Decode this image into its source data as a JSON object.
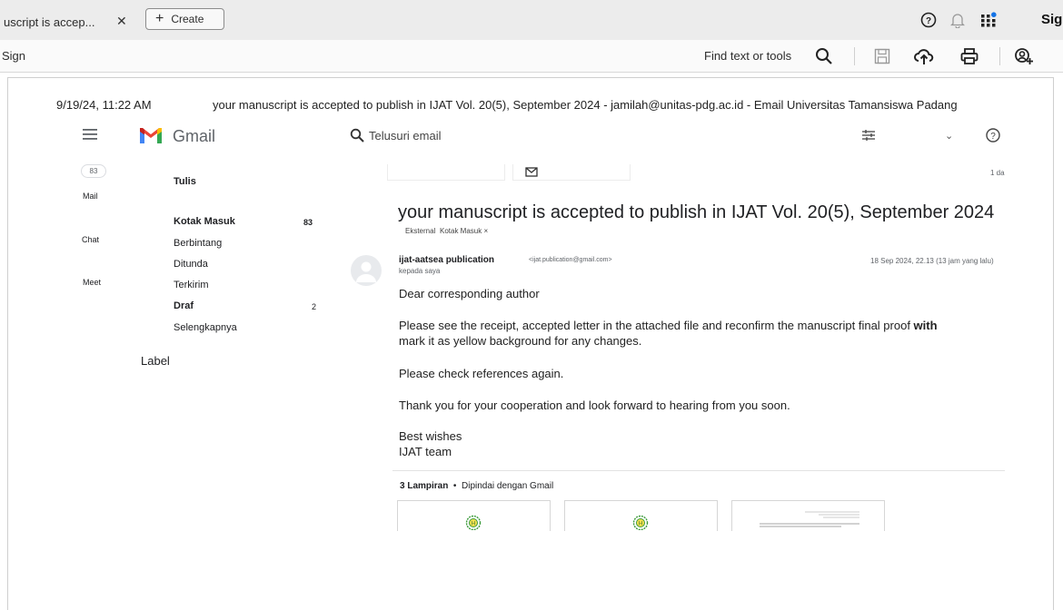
{
  "acrobat": {
    "tab_title": "uscript is accep...",
    "tab_close": "✕",
    "create_label": "Create",
    "create_plus": "+",
    "top_right_label": "Sig",
    "sign_label": "Sign",
    "find_label": "Find text or tools",
    "icons": [
      "help-icon",
      "bell-icon",
      "apps-icon",
      "search-icon",
      "save-icon",
      "upload-cloud-icon",
      "print-icon",
      "share-user-icon"
    ]
  },
  "print_header": {
    "datetime": "9/19/24, 11:22 AM",
    "subject": "your manuscript is accepted to publish in IJAT Vol. 20(5), September 2024 - jamilah@unitas-pdg.ac.id - Email Universitas Tamansiswa Padang"
  },
  "gmail": {
    "brand": "Gmail",
    "search_placeholder": "Telusuri email",
    "rail": {
      "badge": "83",
      "mail": "Mail",
      "chat": "Chat",
      "meet": "Meet"
    },
    "nav": {
      "compose": "Tulis",
      "inbox": "Kotak Masuk",
      "inbox_count": "83",
      "starred": "Berbintang",
      "snoozed": "Ditunda",
      "sent": "Terkirim",
      "drafts": "Draf",
      "drafts_count": "2",
      "more": "Selengkapnya",
      "labels": "Label"
    },
    "colors": {
      "red": "#ea4335",
      "blue": "#4285f4",
      "green": "#34a853",
      "yellow": "#fbbc04"
    }
  },
  "message": {
    "age": "1 da",
    "subject": "your manuscript is accepted to publish in IJAT Vol. 20(5), September 2024",
    "tags": [
      "Eksternal",
      "Kotak Masuk ×"
    ],
    "sender_name": "ijat-aatsea publication",
    "sender_email": "<ijat.publication@gmail.com>",
    "to": "kepada saya",
    "date": "18 Sep 2024, 22.13 (13 jam yang lalu)",
    "body": {
      "greeting": "Dear corresponding author",
      "p1_a": "Please see the receipt, accepted letter in the attached file and reconfirm the manuscript final proof ",
      "p1_b": "with",
      "p1_c": "mark it as yellow background for any changes.",
      "p2": "Please check references again.",
      "p3": "Thank you for your cooperation and look forward to hearing from you soon.",
      "sign1": "Best wishes",
      "sign2": "IJAT team"
    },
    "attachments": {
      "count_label": "3 Lampiran",
      "dot": "•",
      "scanned": "Dipindai dengan Gmail"
    }
  }
}
